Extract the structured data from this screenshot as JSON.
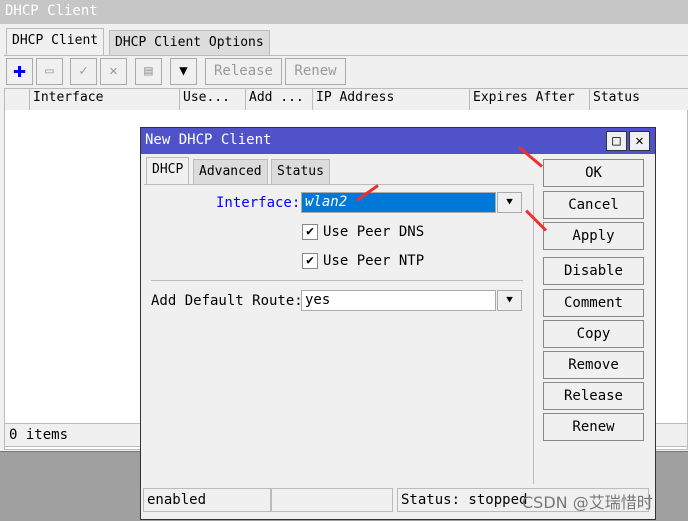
{
  "main_window": {
    "title": "DHCP Client",
    "tabs": [
      "DHCP Client",
      "DHCP Client Options"
    ],
    "toolbar": {
      "add": "plus-icon",
      "remove": "minus-icon",
      "enable": "check-icon",
      "disable": "x-icon",
      "comment": "note-icon",
      "filter": "filter-icon",
      "release": "Release",
      "renew": "Renew"
    },
    "columns": [
      "",
      "Interface",
      "Use...",
      "Add ...",
      "IP Address",
      "Expires After",
      "Status"
    ],
    "rows": [],
    "status": "0 items"
  },
  "dialog": {
    "title": "New DHCP Client",
    "tabs": [
      "DHCP",
      "Advanced",
      "Status"
    ],
    "interface_label": "Interface:",
    "interface_value": "wlan2",
    "use_peer_dns": {
      "label": "Use Peer DNS",
      "checked": true
    },
    "use_peer_ntp": {
      "label": "Use Peer NTP",
      "checked": true
    },
    "default_route_label": "Add Default Route:",
    "default_route_value": "yes",
    "buttons": [
      "OK",
      "Cancel",
      "Apply",
      "Disable",
      "Comment",
      "Copy",
      "Remove",
      "Release",
      "Renew"
    ],
    "status_bar": [
      "enabled",
      "",
      "Status: stopped"
    ]
  },
  "watermark": "CSDN @艾瑞惜时",
  "colors": {
    "title_bar": "#4f52c9",
    "selection": "#0078d7",
    "label_blue": "#0000ff",
    "arrow": "#f03030"
  }
}
